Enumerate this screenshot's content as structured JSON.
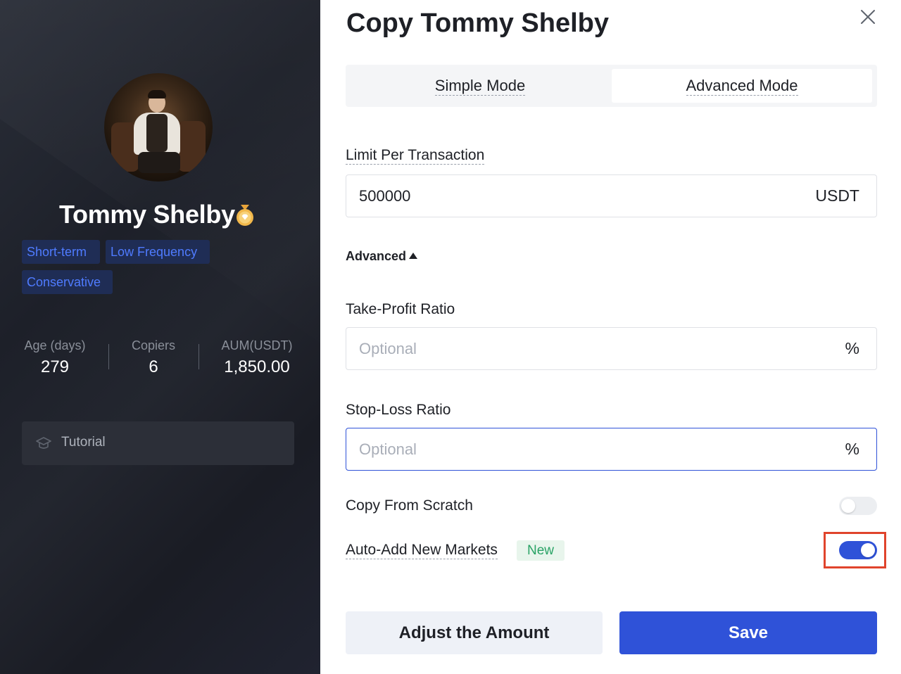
{
  "trader": {
    "name": "Tommy Shelby",
    "tags": [
      "Short-term",
      "Low Frequency",
      "Conservative"
    ],
    "stats": [
      {
        "label": "Age (days)",
        "value": "279"
      },
      {
        "label": "Copiers",
        "value": "6"
      },
      {
        "label": "AUM(USDT)",
        "value": "1,850.00"
      }
    ],
    "tutorial_label": "Tutorial",
    "medal_icon": "medal-icon",
    "tutorial_icon": "graduation-cap-icon"
  },
  "modal": {
    "title": "Copy Tommy Shelby",
    "close_icon": "close-icon",
    "tabs": [
      {
        "label": "Simple Mode",
        "active": false
      },
      {
        "label": "Advanced Mode",
        "active": true
      }
    ],
    "limit": {
      "label": "Limit Per Transaction",
      "value": "500000",
      "unit": "USDT"
    },
    "advanced_label": "Advanced",
    "take_profit": {
      "label": "Take-Profit Ratio",
      "placeholder": "Optional",
      "unit": "%"
    },
    "stop_loss": {
      "label": "Stop-Loss Ratio",
      "placeholder": "Optional",
      "unit": "%"
    },
    "copy_from_scratch": {
      "label": "Copy From Scratch",
      "enabled": false
    },
    "auto_add": {
      "label": "Auto-Add New Markets",
      "badge": "New",
      "enabled": true
    },
    "buttons": {
      "adjust": "Adjust the Amount",
      "save": "Save"
    }
  },
  "colors": {
    "accent": "#2f52d8",
    "tag_text": "#4f7bff",
    "tag_bg": "#1f2d55",
    "new_badge_text": "#2aa366",
    "highlight": "#e0442c"
  }
}
